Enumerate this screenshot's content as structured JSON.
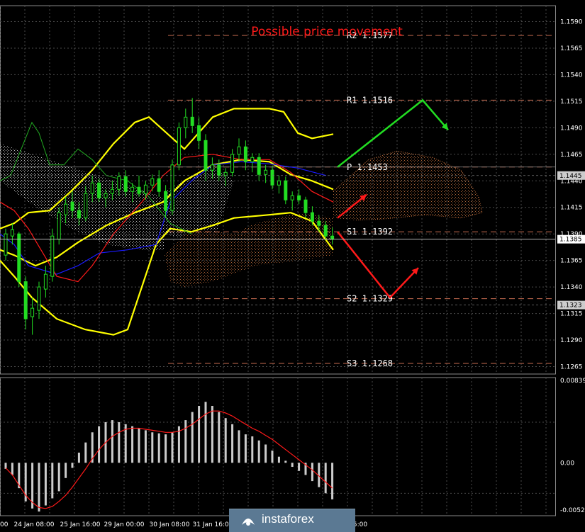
{
  "chart_data": {
    "type": "line",
    "title": "Possible price movement",
    "price_axis": {
      "ticks": [
        "1.1590",
        "1.1565",
        "1.1540",
        "1.1515",
        "1.1490",
        "1.1465",
        "1.1440",
        "1.1415",
        "1.1390",
        "1.1365",
        "1.1340",
        "1.1315",
        "1.1290",
        "1.1265"
      ],
      "range": [
        1.1258,
        1.1605
      ]
    },
    "time_axis": {
      "ticks": [
        "00",
        "24 Jan 08:00",
        "25 Jan 16:00",
        "29 Jan 00:00",
        "30 Jan 08:00",
        "31 Jan 16:00",
        "5:00"
      ]
    },
    "levels": [
      {
        "name": "R2",
        "value": 1.1577,
        "label": "R2  1.1577"
      },
      {
        "name": "R1",
        "value": 1.1516,
        "label": "R1  1.1516"
      },
      {
        "name": "P",
        "value": 1.1453,
        "label": "P  1.1453"
      },
      {
        "name": "S1",
        "value": 1.1392,
        "label": "S1  1.1392"
      },
      {
        "name": "S2",
        "value": 1.1329,
        "label": "S2  1.1329"
      },
      {
        "name": "S3",
        "value": 1.1268,
        "label": "S3  1.1268"
      }
    ],
    "price_tags": [
      {
        "value": 1.1445,
        "label": "1.1445"
      },
      {
        "value": 1.1385,
        "label": "1.1385"
      },
      {
        "value": 1.1323,
        "label": "1.1323"
      }
    ],
    "candles": [
      [
        1.137,
        1.1395,
        1.1365,
        1.139
      ],
      [
        1.1388,
        1.14,
        1.138,
        1.1394
      ],
      [
        1.139,
        1.1392,
        1.134,
        1.1345
      ],
      [
        1.1345,
        1.135,
        1.13,
        1.131
      ],
      [
        1.1312,
        1.133,
        1.1295,
        1.132
      ],
      [
        1.1318,
        1.1345,
        1.131,
        1.134
      ],
      [
        1.1338,
        1.136,
        1.133,
        1.1352
      ],
      [
        1.135,
        1.1395,
        1.1345,
        1.1388
      ],
      [
        1.1385,
        1.1415,
        1.138,
        1.141
      ],
      [
        1.1408,
        1.1425,
        1.14,
        1.1418
      ],
      [
        1.142,
        1.143,
        1.1405,
        1.1412
      ],
      [
        1.1412,
        1.142,
        1.1398,
        1.1405
      ],
      [
        1.1405,
        1.1435,
        1.1402,
        1.1428
      ],
      [
        1.1428,
        1.1445,
        1.142,
        1.1438
      ],
      [
        1.1438,
        1.1442,
        1.142,
        1.1424
      ],
      [
        1.1424,
        1.1432,
        1.1415,
        1.1428
      ],
      [
        1.1428,
        1.144,
        1.1422,
        1.1432
      ],
      [
        1.1432,
        1.1448,
        1.1426,
        1.1444
      ],
      [
        1.1444,
        1.145,
        1.1425,
        1.143
      ],
      [
        1.143,
        1.1438,
        1.142,
        1.1434
      ],
      [
        1.1434,
        1.1445,
        1.1425,
        1.1428
      ],
      [
        1.1428,
        1.144,
        1.1422,
        1.1436
      ],
      [
        1.1436,
        1.1446,
        1.143,
        1.1442
      ],
      [
        1.1442,
        1.145,
        1.1425,
        1.143
      ],
      [
        1.143,
        1.1436,
        1.1405,
        1.1412
      ],
      [
        1.1412,
        1.146,
        1.1408,
        1.1455
      ],
      [
        1.1455,
        1.1495,
        1.145,
        1.149
      ],
      [
        1.149,
        1.1508,
        1.148,
        1.15
      ],
      [
        1.15,
        1.1518,
        1.1485,
        1.1492
      ],
      [
        1.1492,
        1.15,
        1.147,
        1.1478
      ],
      [
        1.1478,
        1.1484,
        1.144,
        1.145
      ],
      [
        1.145,
        1.1462,
        1.1442,
        1.1455
      ],
      [
        1.1455,
        1.146,
        1.144,
        1.1445
      ],
      [
        1.1445,
        1.1452,
        1.1435,
        1.1448
      ],
      [
        1.1448,
        1.147,
        1.1444,
        1.1465
      ],
      [
        1.1465,
        1.148,
        1.1458,
        1.1472
      ],
      [
        1.1472,
        1.1478,
        1.145,
        1.1458
      ],
      [
        1.1458,
        1.1466,
        1.1448,
        1.1462
      ],
      [
        1.1462,
        1.1466,
        1.144,
        1.1446
      ],
      [
        1.1446,
        1.1455,
        1.1438,
        1.145
      ],
      [
        1.145,
        1.1454,
        1.1432,
        1.1436
      ],
      [
        1.1436,
        1.1445,
        1.1428,
        1.144
      ],
      [
        1.144,
        1.1444,
        1.1418,
        1.1422
      ],
      [
        1.1422,
        1.143,
        1.1412,
        1.1426
      ],
      [
        1.1426,
        1.1432,
        1.1418,
        1.1422
      ],
      [
        1.1422,
        1.1425,
        1.1405,
        1.141
      ],
      [
        1.141,
        1.1416,
        1.1398,
        1.1402
      ],
      [
        1.1402,
        1.1408,
        1.1392,
        1.1398
      ],
      [
        1.1398,
        1.1402,
        1.1384,
        1.1388
      ],
      [
        1.1388,
        1.1396,
        1.138,
        1.1385
      ]
    ],
    "oscillator": {
      "axis_ticks": [
        "0.00839",
        "0.00",
        "-0.00521"
      ],
      "range": [
        -0.00521,
        0.00839
      ],
      "histogram": [
        -0.0006,
        -0.0012,
        -0.0025,
        -0.0038,
        -0.0045,
        -0.0048,
        -0.0042,
        -0.0035,
        -0.0028,
        -0.0015,
        -0.0005,
        0.001,
        0.002,
        0.003,
        0.0036,
        0.004,
        0.0042,
        0.004,
        0.0038,
        0.0036,
        0.0034,
        0.0032,
        0.003,
        0.0029,
        0.0028,
        0.003,
        0.0036,
        0.0042,
        0.005,
        0.0056,
        0.006,
        0.0056,
        0.005,
        0.0044,
        0.0038,
        0.0032,
        0.0028,
        0.0026,
        0.0022,
        0.0018,
        0.0012,
        0.0006,
        0.0002,
        -0.0004,
        -0.0008,
        -0.0012,
        -0.0018,
        -0.0024,
        -0.003,
        -0.0036
      ],
      "signal": [
        -0.0005,
        -0.0012,
        -0.0022,
        -0.0032,
        -0.0039,
        -0.0044,
        -0.0045,
        -0.0043,
        -0.0038,
        -0.0032,
        -0.0024,
        -0.0015,
        -0.0006,
        0.0004,
        0.0013,
        0.002,
        0.0026,
        0.003,
        0.0033,
        0.0034,
        0.0034,
        0.0033,
        0.0032,
        0.0031,
        0.003,
        0.003,
        0.0031,
        0.0034,
        0.0038,
        0.0043,
        0.0048,
        0.0051,
        0.0051,
        0.0049,
        0.0046,
        0.0042,
        0.0038,
        0.0034,
        0.0031,
        0.0027,
        0.0023,
        0.0018,
        0.0013,
        0.0008,
        0.0003,
        -0.0002,
        -0.0007,
        -0.0013,
        -0.0019,
        -0.0025
      ]
    },
    "colors": {
      "background": "#000000",
      "grid": "#4a4a4a",
      "candle": "#22dd22",
      "bollinger": "#ffff00",
      "kijun": "#ff1a1a",
      "tenkan": "#1a1aff",
      "chikou": "#22aa22",
      "cloud_up": "#e0e0e0",
      "cloud_down": "#b86a3a",
      "level_line": "#c86c50",
      "arrow_up": "#22dd22",
      "arrow_down": "#ff1a1a",
      "histogram": "#cccccc",
      "signal": "#ff1a1a"
    }
  },
  "watermark": {
    "text": "instaforex"
  }
}
